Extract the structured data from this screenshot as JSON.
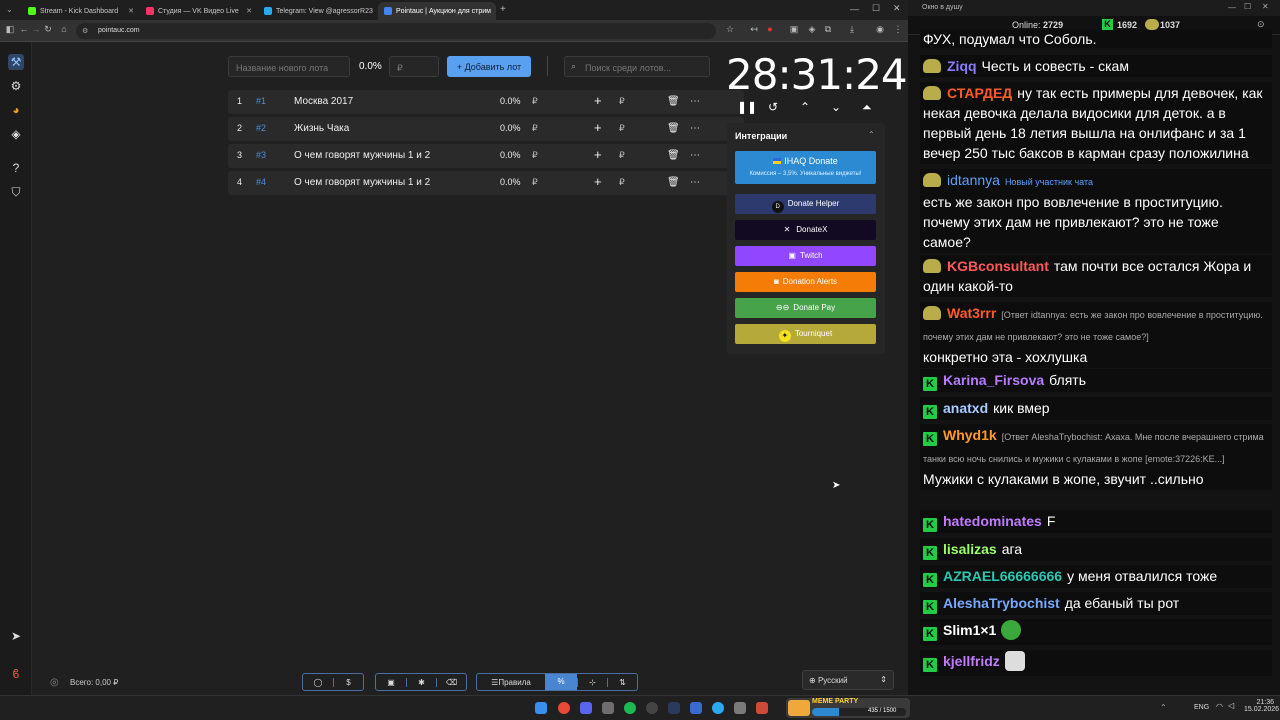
{
  "browser": {
    "tabs": [
      {
        "label": "Stream - Kick Dashboard",
        "color": "#53fc18"
      },
      {
        "label": "Студия — VK Видео Live",
        "color": "#ff3366"
      },
      {
        "label": "Telegram: View @agressorR23",
        "color": "#2aabee"
      },
      {
        "label": "Pointauc | Аукцион для стрим",
        "color": "#4285f4"
      }
    ],
    "url": "pointauc.com"
  },
  "toolbar": {
    "lot_name_placeholder": "Название нового лота",
    "percent": "0.0%",
    "amount_placeholder": "₽",
    "add_label": "Добавить лот",
    "search_placeholder": "Поиск среди лотов..."
  },
  "lots": [
    {
      "rank": "1",
      "id": "#1",
      "name": "Москва 2017",
      "percent": "0.0%",
      "currency": "₽"
    },
    {
      "rank": "2",
      "id": "#2",
      "name": "Жизнь Чака",
      "percent": "0.0%",
      "currency": "₽"
    },
    {
      "rank": "3",
      "id": "#3",
      "name": "О чем говорят мужчины 1 и 2",
      "percent": "0.0%",
      "currency": "₽"
    },
    {
      "rank": "4",
      "id": "#4",
      "name": "О чем говорят мужчины 1 и 2",
      "percent": "0.0%",
      "currency": "₽"
    }
  ],
  "timer": {
    "value": "28:31:24"
  },
  "integrations": {
    "title": "Интеграции",
    "ihaq": {
      "label": "IHAQ Donate",
      "sub": "Комиссия – 3,5%. Уникальные виджеты!"
    },
    "items": [
      {
        "label": "Donate Helper",
        "color": "#2c3a6e"
      },
      {
        "label": "DonateX",
        "color": "#120a22"
      },
      {
        "label": "Twitch",
        "color": "#9146ff"
      },
      {
        "label": "Donation Alerts",
        "color": "#f57d07"
      },
      {
        "label": "Donate Pay",
        "color": "#46a34a"
      },
      {
        "label": "Tourniquet",
        "color": "#b5a93a"
      }
    ]
  },
  "footer": {
    "total": "Всего: 0,00 ₽",
    "rules_label": "Правила",
    "language": "Русский"
  },
  "chat": {
    "window_title": "Окно в душу",
    "online_label": "Online:",
    "online": "2729",
    "kick_count": "1692",
    "vk_count": "1037",
    "messages": [
      {
        "nick": "",
        "text": "ФУХ, подумал что Соболь.",
        "badge": "none",
        "color": "#ffffff"
      },
      {
        "nick": "Ziqq",
        "text": "Честь и совесть - скам",
        "badge": "pepe",
        "color": "#8a7cff"
      },
      {
        "nick": "СТАРДЕД",
        "text": "ну так есть примеры для девочек, как некая девочка делала видосики для деток. а в первый день 18 летия вышла на онлифанс и за 1 вечер 250 тыс баксов в карман сразу положилина",
        "badge": "pepe",
        "color": "#ff5a2a"
      },
      {
        "nick": "idtannya",
        "tag": "Новый участник чата",
        "text": "есть же закон про вовлечение в проституцию. почему этих дам не привлекают? это не тоже самое?",
        "badge": "pepe",
        "color": "#5aa0ff"
      },
      {
        "nick": "KGBconsultant",
        "text": "там почти все остался Жора и один какой-то",
        "badge": "pepe",
        "color": "#ff5a5a"
      },
      {
        "nick": "Wat3rrr",
        "reply": "[Ответ idtannya: есть же закон про вовлечение в проституцию. почему этих дам не привлекают? это не тоже самое?]",
        "text": "конкретно эта - хохлушка",
        "badge": "pepe",
        "color": "#ff5a2a"
      },
      {
        "nick": "Karina_Firsova",
        "text": "блять",
        "badge": "kick",
        "color": "#b57cff"
      },
      {
        "nick": "anatxd",
        "text": "кик вмер",
        "badge": "kick",
        "color": "#aaccff"
      },
      {
        "nick": "Whyd1k",
        "reply": "[Ответ AleshaTrybochist: Ахаха. Мне после вчерашнего стрима танки всю ночь снились и мужики с кулаками в жопе [emote:37226:KE...]",
        "text": "Мужики с кулаками в жопе, звучит ..сильно",
        "badge": "kick",
        "color": "#ff9a2a"
      },
      {
        "nick": "hatedominates",
        "text": "F",
        "badge": "kick",
        "color": "#c07cff"
      },
      {
        "nick": "lisalizas",
        "text": "ага",
        "badge": "kick",
        "color": "#9cff6a"
      },
      {
        "nick": "AZRAEL66666666",
        "text": "у меня отвалился тоже",
        "badge": "kick",
        "color": "#2ac8b0"
      },
      {
        "nick": "AleshaTrybochist",
        "text": "да ебаный ты рот",
        "badge": "kick",
        "color": "#7aa8ff"
      },
      {
        "nick": "Slim1×1",
        "text": "",
        "badge": "kick",
        "color": "#ffffff",
        "emote": "#3aa83a"
      },
      {
        "nick": "kjellfridz",
        "text": "",
        "badge": "kick",
        "color": "#c07cff",
        "emote": "#dddddd"
      }
    ]
  },
  "taskbar": {
    "widget_text": "MEME PARTY",
    "widget_progress": "435 / 1500",
    "lang": "ENG",
    "time": "21:36",
    "date": "15.02.2026"
  }
}
